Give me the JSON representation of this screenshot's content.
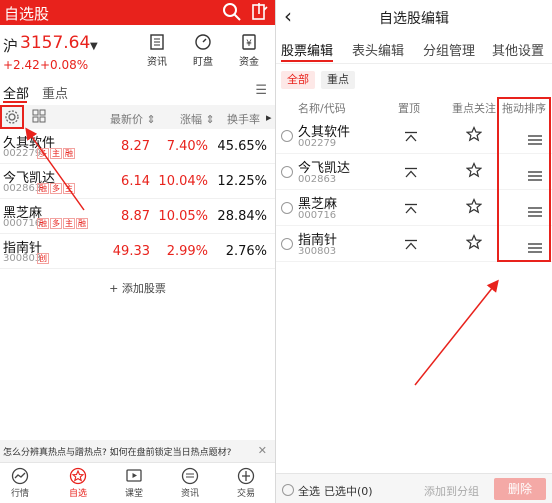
{
  "left": {
    "title": "自选股",
    "index": {
      "name": "沪",
      "value": "3157.64",
      "change": "+2.42",
      "change_pct": "+0.08%"
    },
    "tools": [
      {
        "label": "资讯",
        "icon": "news-icon"
      },
      {
        "label": "盯盘",
        "icon": "watch-icon"
      },
      {
        "label": "资金",
        "icon": "money-icon"
      }
    ],
    "tabs": [
      "全部",
      "重点"
    ],
    "columns": [
      "最新价",
      "涨幅",
      "换手率"
    ],
    "stocks": [
      {
        "name": "久其软件",
        "code": "002279",
        "tags": [
          "多",
          "主",
          "融"
        ],
        "price": "8.27",
        "pct": "7.40%",
        "turnover": "45.65%"
      },
      {
        "name": "今飞凯达",
        "code": "002863",
        "tags": [
          "融",
          "多",
          "主"
        ],
        "price": "6.14",
        "pct": "10.04%",
        "turnover": "12.25%"
      },
      {
        "name": "黑芝麻",
        "code": "000716",
        "tags": [
          "融",
          "多",
          "主",
          "融"
        ],
        "price": "8.87",
        "pct": "10.05%",
        "turnover": "28.84%"
      },
      {
        "name": "指南针",
        "code": "300803",
        "tags": [
          "创"
        ],
        "price": "49.33",
        "pct": "2.99%",
        "turnover": "2.76%"
      }
    ],
    "add_stock": "+ 添加股票",
    "banner": "怎么分辨真热点与蹭热点? 如何在盘前锁定当日热点题材?",
    "nav": [
      "行情",
      "自选",
      "课堂",
      "资讯",
      "交易"
    ]
  },
  "right": {
    "title": "自选股编辑",
    "tabs": [
      "股票编辑",
      "表头编辑",
      "分组管理",
      "其他设置"
    ],
    "chips": [
      "全部",
      "重点"
    ],
    "columns": {
      "name": "名称/代码",
      "top": "置顶",
      "focus": "重点关注",
      "drag": "拖动排序"
    },
    "stocks": [
      {
        "name": "久其软件",
        "code": "002279"
      },
      {
        "name": "今飞凯达",
        "code": "002863"
      },
      {
        "name": "黑芝麻",
        "code": "000716"
      },
      {
        "name": "指南针",
        "code": "300803"
      }
    ],
    "footer": {
      "select_all": "全选",
      "selected": "已选中(0)",
      "add_group": "添加到分组",
      "delete": "删除"
    }
  },
  "colors": {
    "accent": "#e8221c",
    "up": "#e8221c"
  }
}
